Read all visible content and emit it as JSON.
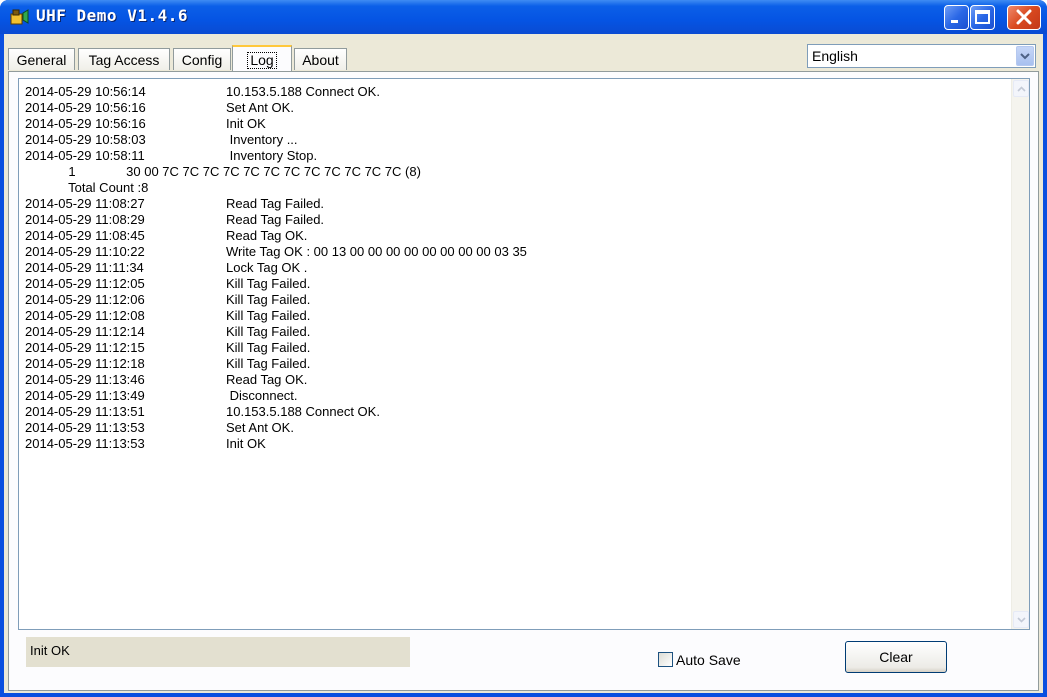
{
  "window": {
    "title": "UHF Demo V1.4.6",
    "app_icon": "rfid-reader-icon",
    "controls": [
      "minimize-icon",
      "maximize-icon",
      "close-icon"
    ]
  },
  "tabs": [
    {
      "label": "General"
    },
    {
      "label": "Tag Access"
    },
    {
      "label": "Config"
    },
    {
      "label": "Log",
      "selected": true
    },
    {
      "label": "About"
    }
  ],
  "language": {
    "selected": "English"
  },
  "log": {
    "lines": [
      {
        "time": "2014-05-29 10:56:14",
        "message": "10.153.5.188 Connect OK."
      },
      {
        "time": "2014-05-29 10:56:16",
        "message": "Set Ant OK."
      },
      {
        "time": "2014-05-29 10:56:16",
        "message": "Init OK"
      },
      {
        "time": "2014-05-29 10:58:03",
        "message": " Inventory ..."
      },
      {
        "time": "2014-05-29 10:58:11",
        "message": " Inventory Stop."
      },
      {
        "time": "",
        "message": "",
        "raw": "            1              30 00 7C 7C 7C 7C 7C 7C 7C 7C 7C 7C 7C 7C (8)"
      },
      {
        "time": "",
        "message": "",
        "raw": "            Total Count :8"
      },
      {
        "time": "2014-05-29 11:08:27",
        "message": "Read Tag Failed."
      },
      {
        "time": "2014-05-29 11:08:29",
        "message": "Read Tag Failed."
      },
      {
        "time": "2014-05-29 11:08:45",
        "message": "Read Tag OK."
      },
      {
        "time": "2014-05-29 11:10:22",
        "message": "Write Tag OK : 00 13 00 00 00 00 00 00 00 00 03 35"
      },
      {
        "time": "2014-05-29 11:11:34",
        "message": "Lock Tag OK ."
      },
      {
        "time": "2014-05-29 11:12:05",
        "message": "Kill Tag Failed."
      },
      {
        "time": "2014-05-29 11:12:06",
        "message": "Kill Tag Failed."
      },
      {
        "time": "2014-05-29 11:12:08",
        "message": "Kill Tag Failed."
      },
      {
        "time": "2014-05-29 11:12:14",
        "message": "Kill Tag Failed."
      },
      {
        "time": "2014-05-29 11:12:15",
        "message": "Kill Tag Failed."
      },
      {
        "time": "2014-05-29 11:12:18",
        "message": "Kill Tag Failed."
      },
      {
        "time": "2014-05-29 11:13:46",
        "message": "Read Tag OK."
      },
      {
        "time": "2014-05-29 11:13:49",
        "message": " Disconnect."
      },
      {
        "time": "2014-05-29 11:13:51",
        "message": "10.153.5.188 Connect OK."
      },
      {
        "time": "2014-05-29 11:13:53",
        "message": "Set Ant OK."
      },
      {
        "time": "2014-05-29 11:13:53",
        "message": "Init OK"
      }
    ]
  },
  "status": {
    "text": "Init OK"
  },
  "auto_save": {
    "label": "Auto Save",
    "checked": false
  },
  "clear_button": {
    "label": "Clear"
  },
  "colors": {
    "titlebar": "#0554e3",
    "client": "#ece9d8",
    "active_tab_accent": "#ffc83c",
    "close_button": "#d9491f"
  }
}
